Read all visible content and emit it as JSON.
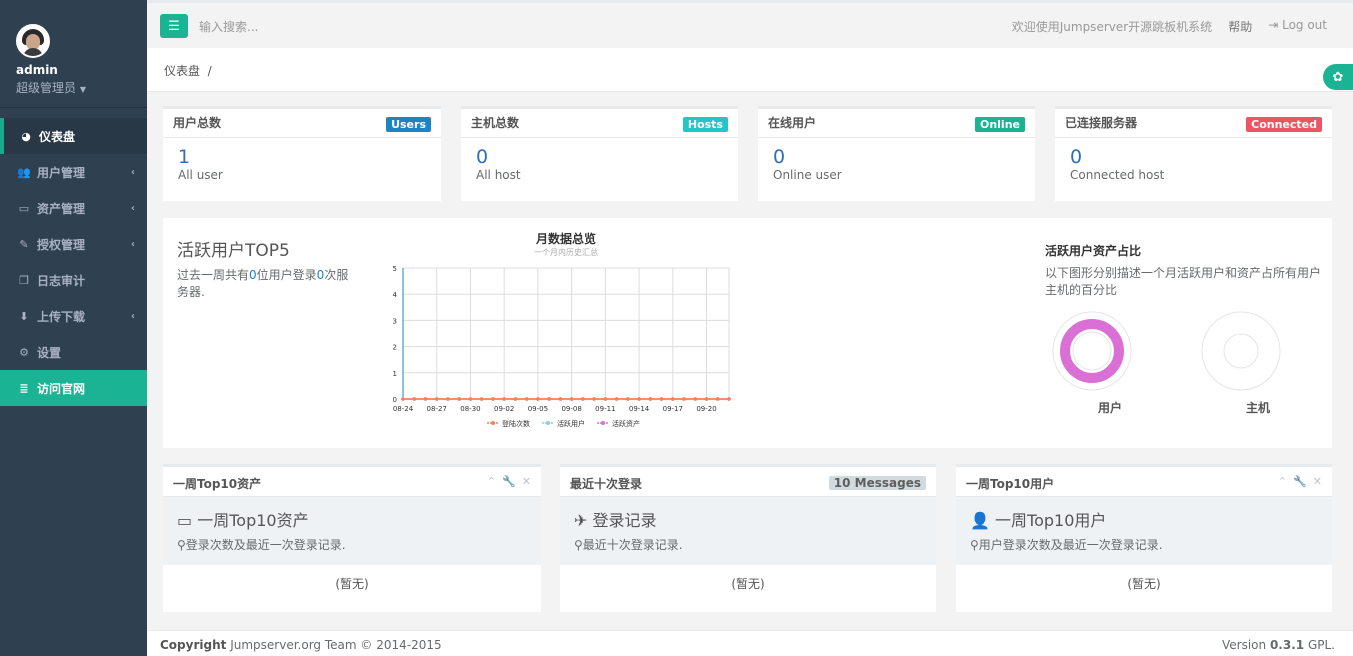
{
  "sidebar": {
    "user": {
      "name": "admin",
      "role": "超级管理员"
    },
    "items": [
      {
        "label": "仪表盘",
        "icon": "dashboard-icon",
        "active": true,
        "expandable": false
      },
      {
        "label": "用户管理",
        "icon": "users-icon",
        "expandable": true
      },
      {
        "label": "资产管理",
        "icon": "inbox-icon",
        "expandable": true
      },
      {
        "label": "授权管理",
        "icon": "edit-icon",
        "expandable": true
      },
      {
        "label": "日志审计",
        "icon": "files-icon",
        "expandable": false
      },
      {
        "label": "上传下载",
        "icon": "download-icon",
        "expandable": true
      },
      {
        "label": "设置",
        "icon": "cogs-icon",
        "expandable": false
      },
      {
        "label": "访问官网",
        "icon": "database-icon",
        "expandable": false,
        "highlight": true
      }
    ]
  },
  "topbar": {
    "search_placeholder": "输入搜索...",
    "welcome": "欢迎使用Jumpserver开源跳板机系统",
    "help": "帮助",
    "logout": "Log out"
  },
  "breadcrumb": {
    "current": "仪表盘",
    "separator": "/"
  },
  "stats": [
    {
      "title": "用户总数",
      "badge": "Users",
      "badge_color": "#1c84c6",
      "value": "1",
      "sub": "All user"
    },
    {
      "title": "主机总数",
      "badge": "Hosts",
      "badge_color": "#23c6c8",
      "value": "0",
      "sub": "All host"
    },
    {
      "title": "在线用户",
      "badge": "Online",
      "badge_color": "#1ab394",
      "value": "0",
      "sub": "Online user"
    },
    {
      "title": "已连接服务器",
      "badge": "Connected",
      "badge_color": "#ed5565",
      "value": "0",
      "sub": "Connected host"
    }
  ],
  "top5": {
    "title": "活跃用户TOP5",
    "desc_prefix": "过去一周共有",
    "user_count": "0",
    "desc_mid": "位用户登录",
    "login_count": "0",
    "desc_suffix": "次服务器."
  },
  "chart_data": {
    "type": "line",
    "title": "月数据总览",
    "subtitle": "一个月内历史汇总",
    "x": [
      "08-24",
      "08-25",
      "08-26",
      "08-27",
      "08-28",
      "08-29",
      "08-30",
      "08-31",
      "09-01",
      "09-02",
      "09-03",
      "09-04",
      "09-05",
      "09-06",
      "09-07",
      "09-08",
      "09-09",
      "09-10",
      "09-11",
      "09-12",
      "09-13",
      "09-14",
      "09-15",
      "09-16",
      "09-17",
      "09-18",
      "09-19",
      "09-20",
      "09-21",
      "09-22"
    ],
    "x_tick_labels": [
      "08-24",
      "08-27",
      "08-30",
      "09-02",
      "09-05",
      "09-08",
      "09-11",
      "09-14",
      "09-17",
      "09-20"
    ],
    "ylim": [
      0,
      5
    ],
    "y_ticks": [
      0,
      1,
      2,
      3,
      4,
      5
    ],
    "grid": true,
    "legend_position": "bottom",
    "series": [
      {
        "name": "登陆次数",
        "color": "#ff7f50",
        "values": [
          0,
          0,
          0,
          0,
          0,
          0,
          0,
          0,
          0,
          0,
          0,
          0,
          0,
          0,
          0,
          0,
          0,
          0,
          0,
          0,
          0,
          0,
          0,
          0,
          0,
          0,
          0,
          0,
          0,
          0
        ]
      },
      {
        "name": "活跃用户",
        "color": "#87cefa",
        "values": [
          0,
          0,
          0,
          0,
          0,
          0,
          0,
          0,
          0,
          0,
          0,
          0,
          0,
          0,
          0,
          0,
          0,
          0,
          0,
          0,
          0,
          0,
          0,
          0,
          0,
          0,
          0,
          0,
          0,
          0
        ]
      },
      {
        "name": "活跃资产",
        "color": "#da70d6",
        "values": [
          0,
          0,
          0,
          0,
          0,
          0,
          0,
          0,
          0,
          0,
          0,
          0,
          0,
          0,
          0,
          0,
          0,
          0,
          0,
          0,
          0,
          0,
          0,
          0,
          0,
          0,
          0,
          0,
          0,
          0
        ]
      }
    ]
  },
  "ratio": {
    "title": "活跃用户资产占比",
    "desc": "以下图形分别描述一个月活跃用户和资产占所有用户主机的百分比",
    "user_label": "用户",
    "host_label": "主机",
    "user_ring_color": "#da70d6"
  },
  "panels": [
    {
      "title": "一周Top10资产",
      "icon": "hdd-icon",
      "heading": "一周Top10资产",
      "desc": "登录次数及最近一次登录记录.",
      "empty": "(暂无)",
      "tools": true
    },
    {
      "title": "最近十次登录",
      "icon": "paper-plane-icon",
      "heading": "登录记录",
      "desc": "最近十次登录记录.",
      "empty": "(暂无)",
      "messages": "10 Messages"
    },
    {
      "title": "一周Top10用户",
      "icon": "user-icon",
      "heading": "一周Top10用户",
      "desc": "用户登录次数及最近一次登录记录.",
      "empty": "(暂无)",
      "tools": true
    }
  ],
  "footer": {
    "copyright_label": "Copyright",
    "copyright_text": "Jumpserver.org Team © 2014-2015",
    "version_label": "Version",
    "version_number": "0.3.1",
    "version_suffix": "GPL."
  }
}
